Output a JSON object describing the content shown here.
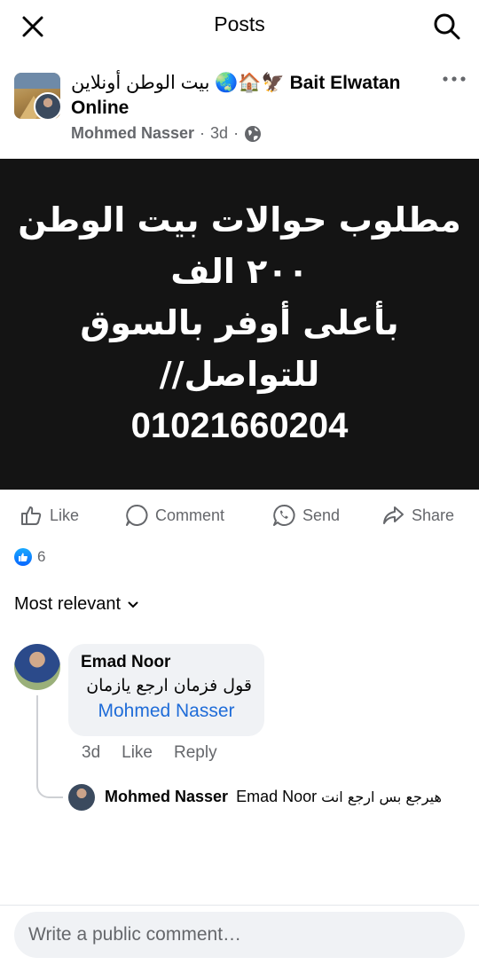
{
  "topbar": {
    "title": "Posts"
  },
  "post": {
    "group_name_ar": "بيت الوطن أونلاين",
    "group_name_emoji": "🌏🏠🦅",
    "group_name_en": "Bait Elwatan Online",
    "author": "Mohmed Nasser",
    "time": "3d",
    "separator": "·",
    "image_lines": [
      "مطلوب حوالات بيت الوطن",
      "٢٠٠ الف",
      "بأعلى أوفر بالسوق",
      "للتواصل//"
    ],
    "image_phone": "01021660204"
  },
  "actions": {
    "like": "Like",
    "comment": "Comment",
    "send": "Send",
    "share": "Share"
  },
  "reactions": {
    "count": "6"
  },
  "sort": {
    "label": "Most relevant"
  },
  "comment": {
    "name": "Emad Noor",
    "text": "قول فزمان ارجع يازمان",
    "mention": "Mohmed Nasser",
    "time": "3d",
    "like": "Like",
    "reply": "Reply"
  },
  "reply": {
    "name": "Mohmed Nasser",
    "mention": "Emad Noor",
    "text": "هيرجع بس ارجع انت"
  },
  "composer": {
    "placeholder": "Write a public comment…"
  },
  "colors": {
    "accent": "#0866ff",
    "mention": "#1f6cd8",
    "muted": "#65676b",
    "image_bg": "#141414"
  }
}
